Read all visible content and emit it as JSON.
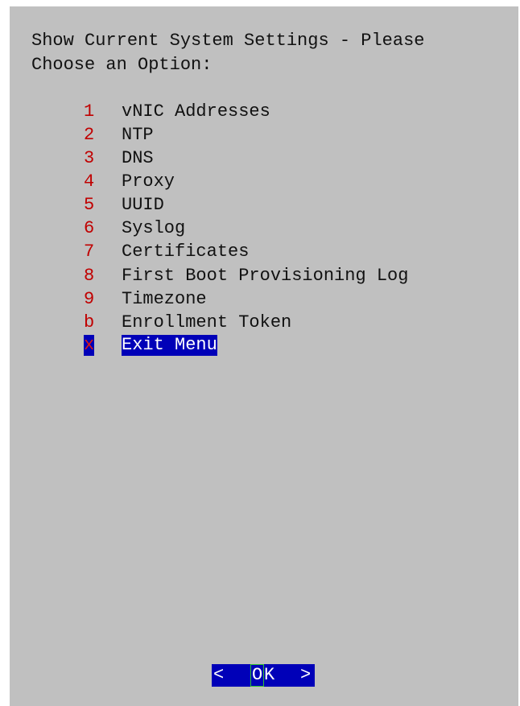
{
  "dialog": {
    "title_line_1": "Show Current System Settings - Please",
    "title_line_2": "Choose an Option:"
  },
  "menu": {
    "items": [
      {
        "key": "1",
        "label": "vNIC Addresses"
      },
      {
        "key": "2",
        "label": "NTP"
      },
      {
        "key": "3",
        "label": "DNS"
      },
      {
        "key": "4",
        "label": "Proxy"
      },
      {
        "key": "5",
        "label": "UUID"
      },
      {
        "key": "6",
        "label": "Syslog"
      },
      {
        "key": "7",
        "label": "Certificates"
      },
      {
        "key": "8",
        "label": "First Boot Provisioning Log"
      },
      {
        "key": "9",
        "label": "Timezone"
      },
      {
        "key": "b",
        "label": "Enrollment Token"
      },
      {
        "key": "x",
        "label": "Exit Menu"
      }
    ],
    "selected_key": "x"
  },
  "buttons": {
    "ok": {
      "left_bracket": "<",
      "hotkey": "O",
      "rest": "K",
      "right_bracket": ">"
    }
  },
  "colors": {
    "background": "#c0c0c0",
    "highlight": "#0000b8",
    "hotkey_text": "#c00000",
    "text": "#111111"
  }
}
